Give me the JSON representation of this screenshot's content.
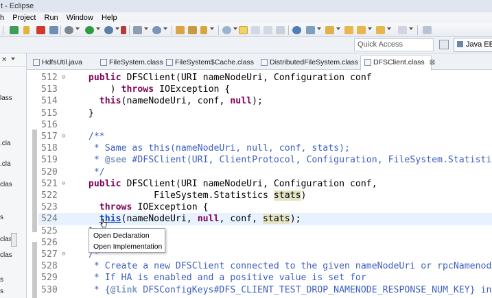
{
  "window": {
    "title": "t - Eclipse"
  },
  "menu": [
    "h",
    "Project",
    "Run",
    "Window",
    "Help"
  ],
  "search": {
    "quick_access_placeholder": "Quick Access"
  },
  "perspective": {
    "java_label": "Java EE"
  },
  "left_panel": {
    "items": [
      "lass",
      ".cla",
      ".cla",
      "clas",
      "s",
      "clas",
      "clas",
      "s",
      "s"
    ]
  },
  "tabs": [
    {
      "label": "HdfsUtil.java",
      "active": false
    },
    {
      "label": "FileSystem.class",
      "active": false
    },
    {
      "label": "FileSystem$Cache.class",
      "active": false
    },
    {
      "label": "DistributedFileSystem.class",
      "active": false
    },
    {
      "label": "DFSClient.class",
      "active": true,
      "close": "⊠"
    }
  ],
  "editor": {
    "lines": [
      {
        "num": "512",
        "fold": "⊖",
        "segments": [
          [
            "  ",
            ""
          ],
          [
            "public",
            "kw"
          ],
          [
            " DFSClient(URI nameNodeUri, Configuration conf",
            ""
          ]
        ]
      },
      {
        "num": "513",
        "fold": "",
        "segments": [
          [
            "      ) ",
            ""
          ],
          [
            "throws",
            "kw"
          ],
          [
            " IOException {",
            ""
          ]
        ]
      },
      {
        "num": "514",
        "fold": "",
        "segments": [
          [
            "    ",
            ""
          ],
          [
            "this",
            "kw"
          ],
          [
            "(nameNodeUri, conf, ",
            ""
          ],
          [
            "null",
            "kw"
          ],
          [
            ");",
            ""
          ]
        ]
      },
      {
        "num": "515",
        "fold": "",
        "segments": [
          [
            "  }",
            ""
          ]
        ]
      },
      {
        "num": "516",
        "fold": "",
        "segments": [
          [
            "",
            ""
          ]
        ]
      },
      {
        "num": "517",
        "fold": "⊖",
        "segments": [
          [
            "  /**",
            "cm"
          ]
        ]
      },
      {
        "num": "518",
        "fold": "",
        "segments": [
          [
            "   * Same as this(nameNodeUri, null, conf, stats);",
            "cm"
          ]
        ]
      },
      {
        "num": "519",
        "fold": "",
        "segments": [
          [
            "   * ",
            "cm"
          ],
          [
            "@see",
            "tag"
          ],
          [
            " #DFSClient(URI, ClientProtocol, Configuration, FileSystem.Statistics)",
            "cm"
          ]
        ]
      },
      {
        "num": "520",
        "fold": "",
        "segments": [
          [
            "   */",
            "cm"
          ]
        ]
      },
      {
        "num": "521",
        "fold": "⊖",
        "segments": [
          [
            "  ",
            ""
          ],
          [
            "public",
            "kw"
          ],
          [
            " DFSClient(URI nameNodeUri, Configuration conf,",
            ""
          ]
        ]
      },
      {
        "num": "522",
        "fold": "",
        "segments": [
          [
            "              FileSystem.Statistics ",
            ""
          ],
          [
            "stats",
            "hl"
          ],
          [
            ")",
            ""
          ]
        ]
      },
      {
        "num": "523",
        "fold": "",
        "segments": [
          [
            "    ",
            ""
          ],
          [
            "throws",
            "kw"
          ],
          [
            " IOException {",
            ""
          ]
        ]
      },
      {
        "num": "524",
        "fold": "",
        "current": true,
        "segments": [
          [
            "    ",
            ""
          ],
          [
            "this",
            "kw link"
          ],
          [
            "(nameNodeUri, ",
            ""
          ],
          [
            "null",
            "kw"
          ],
          [
            ", conf, ",
            ""
          ],
          [
            "stats",
            "hl"
          ],
          [
            ");",
            ""
          ]
        ]
      },
      {
        "num": "525",
        "fold": "",
        "segments": [
          [
            "  }",
            ""
          ]
        ]
      },
      {
        "num": "526",
        "fold": "",
        "segments": [
          [
            "",
            ""
          ]
        ]
      },
      {
        "num": "527",
        "fold": "⊖",
        "segments": [
          [
            "  /*",
            "cm"
          ]
        ]
      },
      {
        "num": "528",
        "fold": "",
        "segments": [
          [
            "   * Create a new DFSClient connected to the given nameNodeUri or rpcNamenode.",
            "cm"
          ]
        ]
      },
      {
        "num": "529",
        "fold": "",
        "segments": [
          [
            "   * If HA is enabled and a positive value is set for",
            "cm"
          ]
        ]
      },
      {
        "num": "530",
        "fold": "",
        "segments": [
          [
            "   * {",
            "cm"
          ],
          [
            "@link",
            "tag"
          ],
          [
            " DFSConfigKeys#DFS_CLIENT_TEST_DROP_NAMENODE_RESPONSE_NUM_KEY} in th",
            "cm"
          ]
        ]
      }
    ]
  },
  "context_menu": {
    "items": [
      "Open Declaration",
      "Open Implementation"
    ]
  }
}
